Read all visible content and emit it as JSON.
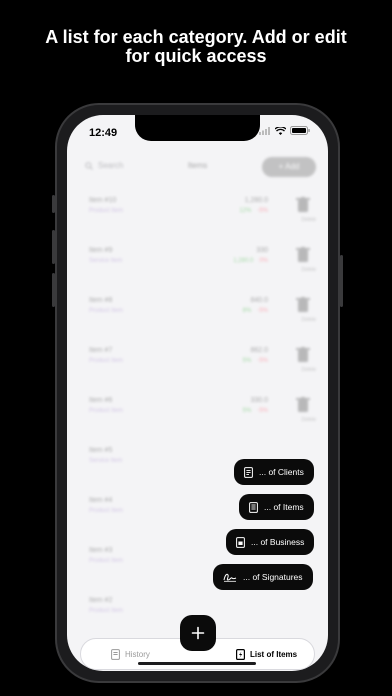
{
  "headline": {
    "line1": "A list for each category. Add or edit",
    "line2": "for quick access"
  },
  "status_bar": {
    "time": "12:49",
    "icons": [
      "signal-icon",
      "wifi-icon",
      "battery-icon"
    ]
  },
  "background_app": {
    "search_placeholder": "Search",
    "nav_title": "Items",
    "add_button_label": "+ Add",
    "trash_label": "Delete",
    "items": [
      {
        "name": "Item #10",
        "sub": "Product Item",
        "price": "1,280.0",
        "tag_a": "12%",
        "tag_b": "-5%"
      },
      {
        "name": "Item #9",
        "sub": "Service Item",
        "price": "330",
        "tag_a": "1,280.0",
        "tag_b": "0%"
      },
      {
        "name": "Item #8",
        "sub": "Product Item",
        "price": "840.0",
        "tag_a": "8%",
        "tag_b": "-5%"
      },
      {
        "name": "Item #7",
        "sub": "Product Item",
        "price": "862.0",
        "tag_a": "5%",
        "tag_b": "-5%"
      },
      {
        "name": "Item #6",
        "sub": "Product Item",
        "price": "330.0",
        "tag_a": "5%",
        "tag_b": "-5%"
      },
      {
        "name": "Item #5",
        "sub": "Service Item",
        "price": "",
        "tag_a": "",
        "tag_b": ""
      },
      {
        "name": "Item #4",
        "sub": "Product Item",
        "price": "",
        "tag_a": "",
        "tag_b": ""
      },
      {
        "name": "Item #3",
        "sub": "Product Item",
        "price": "",
        "tag_a": "",
        "tag_b": ""
      },
      {
        "name": "Item #2",
        "sub": "Product Item",
        "price": "",
        "tag_a": "",
        "tag_b": ""
      }
    ]
  },
  "quick_menu": {
    "clients": "... of Clients",
    "items": "... of Items",
    "business": "... of Business",
    "signatures": "... of Signatures"
  },
  "tab_bar": {
    "history": "History",
    "list_of_items": "List of Items"
  },
  "fab_icon": "plus-icon",
  "colors": {
    "background": "#000000",
    "screen": "#f4f4f6",
    "pill": "#0b0b0b",
    "text_on_dark": "#ffffff"
  }
}
